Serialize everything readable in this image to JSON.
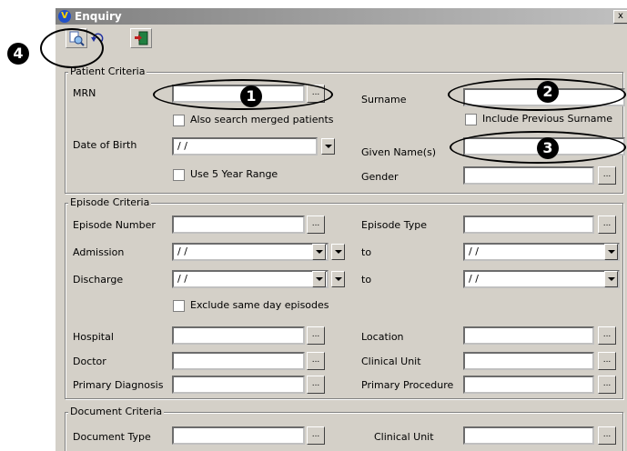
{
  "window": {
    "title": "Enquiry",
    "close_glyph": "x"
  },
  "toolbar": {
    "icons": [
      "search-icon",
      "undo-icon",
      "exit-icon"
    ]
  },
  "patient": {
    "legend": "Patient Criteria",
    "mrn_label": "MRN",
    "merged_label": "Also search merged patients",
    "surname_label": "Surname",
    "prev_surname_label": "Include Previous Surname",
    "dob_label": "Date of Birth",
    "dob_value": "/ /",
    "year_range_label": "Use 5 Year Range",
    "given_label": "Given Name(s)",
    "gender_label": "Gender"
  },
  "episode": {
    "legend": "Episode Criteria",
    "number_label": "Episode Number",
    "type_label": "Episode Type",
    "admission_label": "Admission",
    "discharge_label": "Discharge",
    "to_label": "to",
    "date_value": "/ /",
    "exclude_label": "Exclude same day episodes",
    "hospital_label": "Hospital",
    "location_label": "Location",
    "doctor_label": "Doctor",
    "clinical_unit_label": "Clinical Unit",
    "primary_diag_label": "Primary Diagnosis",
    "primary_proc_label": "Primary Procedure"
  },
  "document": {
    "legend": "Document Criteria",
    "type_label": "Document Type",
    "clinical_unit_label": "Clinical Unit"
  },
  "ellipsis": "...",
  "callouts": [
    "1",
    "2",
    "3",
    "4"
  ]
}
